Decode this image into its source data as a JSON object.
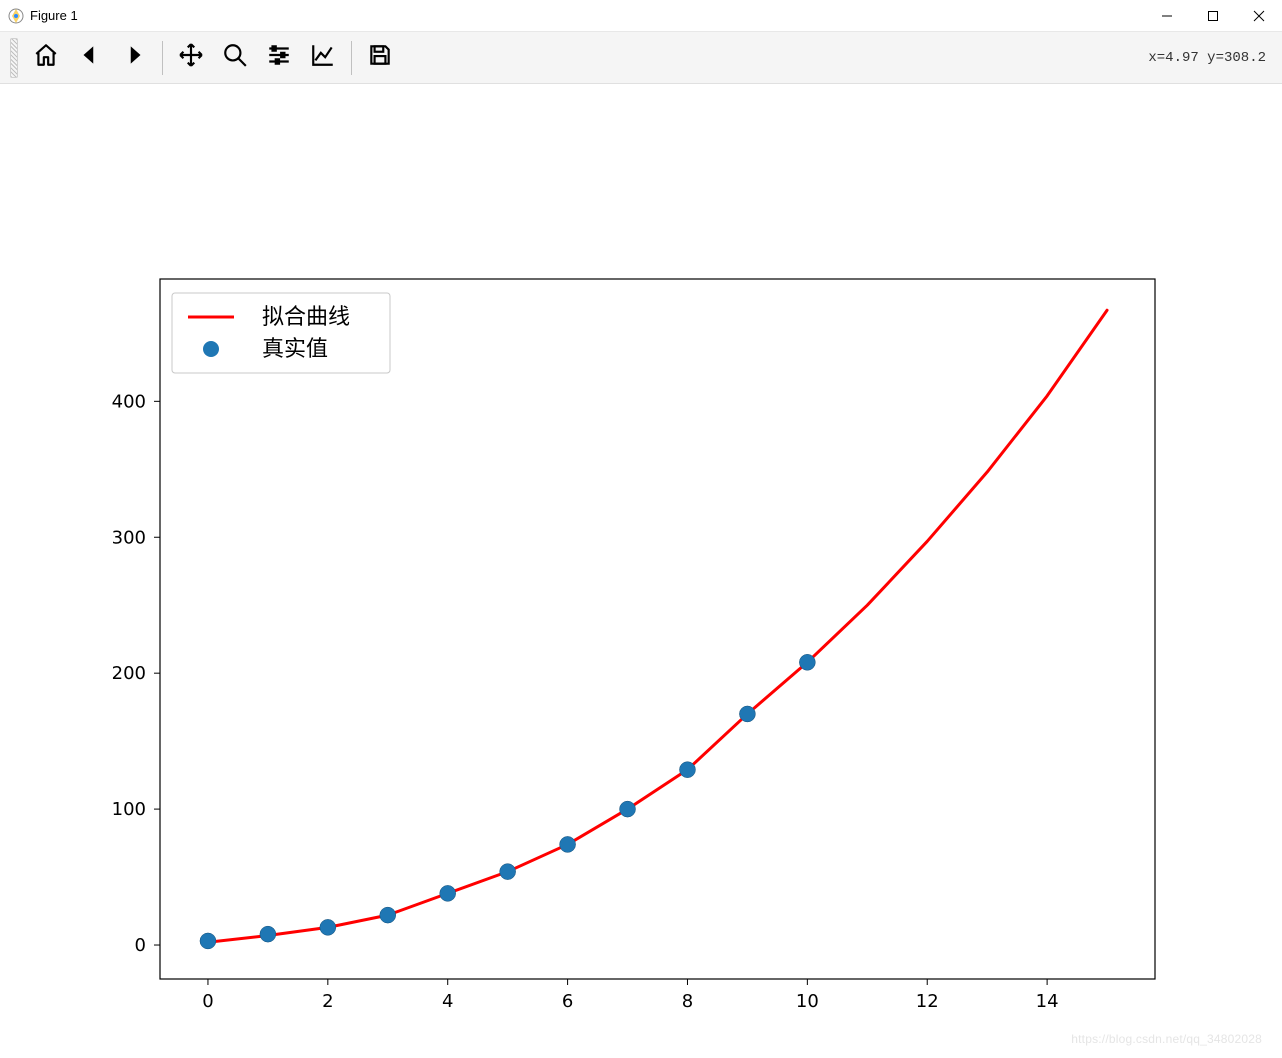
{
  "window": {
    "title": "Figure 1"
  },
  "toolbar": {
    "coords": "x=4.97 y=308.2",
    "buttons": {
      "home": "Home",
      "back": "Back",
      "forward": "Forward",
      "pan": "Pan",
      "zoom": "Zoom",
      "subplots": "Configure subplots",
      "axes": "Edit axis",
      "save": "Save"
    }
  },
  "legend": {
    "line": "拟合曲线",
    "scatter": "真实值"
  },
  "chart_data": {
    "type": "line+scatter",
    "xlabel": "",
    "ylabel": "",
    "xlim": [
      -0.8,
      15.8
    ],
    "ylim": [
      -25,
      490
    ],
    "xticks": [
      0,
      2,
      4,
      6,
      8,
      10,
      12,
      14
    ],
    "yticks": [
      0,
      100,
      200,
      300,
      400
    ],
    "series": [
      {
        "name": "拟合曲线",
        "type": "line",
        "color": "#ff0000",
        "x": [
          0,
          1,
          2,
          3,
          4,
          5,
          6,
          7,
          8,
          9,
          10,
          11,
          12,
          13,
          14,
          15
        ],
        "y": [
          2,
          7,
          13,
          22,
          38,
          54,
          74,
          100,
          129,
          170,
          208,
          250,
          297,
          348,
          404,
          467
        ]
      },
      {
        "name": "真实值",
        "type": "scatter",
        "color": "#1f77b4",
        "x": [
          0,
          1,
          2,
          3,
          4,
          5,
          6,
          7,
          8,
          9,
          10
        ],
        "y": [
          3,
          8,
          13,
          22,
          38,
          54,
          74,
          100,
          129,
          170,
          208
        ]
      }
    ]
  },
  "watermark": "https://blog.csdn.net/qq_34802028"
}
